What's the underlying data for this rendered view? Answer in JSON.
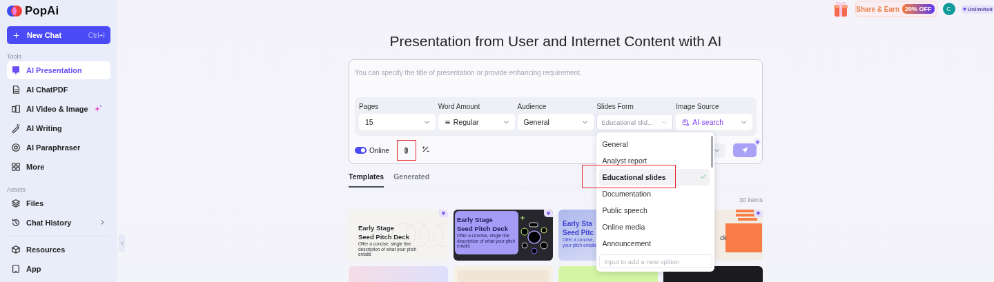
{
  "brand": {
    "name": "PopAi"
  },
  "new_chat": {
    "label": "New Chat",
    "shortcut": "Ctrl+I"
  },
  "sidebar": {
    "sections": [
      {
        "heading": "Tools",
        "items": [
          {
            "label": "AI Presentation",
            "selected": true,
            "sparkle": false,
            "submenu": false
          },
          {
            "label": "AI ChatPDF",
            "selected": false,
            "sparkle": false,
            "submenu": false
          },
          {
            "label": "AI Video & Image",
            "selected": false,
            "sparkle": true,
            "submenu": false
          },
          {
            "label": "AI Writing",
            "selected": false,
            "sparkle": false,
            "submenu": false
          },
          {
            "label": "AI Paraphraser",
            "selected": false,
            "sparkle": false,
            "submenu": false
          },
          {
            "label": "More",
            "selected": false,
            "sparkle": false,
            "submenu": false
          }
        ]
      },
      {
        "heading": "Assets",
        "items": [
          {
            "label": "Files",
            "selected": false,
            "sparkle": false,
            "submenu": false
          },
          {
            "label": "Chat History",
            "selected": false,
            "sparkle": false,
            "submenu": true
          }
        ]
      }
    ],
    "footer_items": [
      {
        "label": "Resources",
        "selected": false,
        "sparkle": false,
        "submenu": false
      },
      {
        "label": "App",
        "selected": false,
        "sparkle": false,
        "submenu": false
      }
    ]
  },
  "topbar": {
    "promo": {
      "label": "Share & Earn",
      "badge": "20% OFF"
    },
    "avatar": {
      "initial": "C"
    },
    "plan": {
      "label": "Unlimited"
    }
  },
  "title": "Presentation from User and Internet Content with AI",
  "prompt": {
    "placeholder": "You can specify the title of presentation or provide enhancing requirement."
  },
  "settings": [
    {
      "label": "Pages",
      "value": "15",
      "kind": "plain",
      "open": false
    },
    {
      "label": "Word Amount",
      "value": "Regular",
      "kind": "lines",
      "open": false
    },
    {
      "label": "Audience",
      "value": "General",
      "kind": "plain",
      "open": false
    },
    {
      "label": "Slides Form",
      "value": "Educational slid...",
      "kind": "plain",
      "open": true
    },
    {
      "label": "Image Source",
      "value": "AI-search",
      "kind": "image",
      "open": false
    }
  ],
  "toolbar": {
    "online": {
      "label": "Online",
      "on": true
    },
    "attach": {
      "annotated": true
    }
  },
  "dropdown": {
    "options": [
      {
        "label": "General",
        "selected": false,
        "annotated": false
      },
      {
        "label": "Analyst report",
        "selected": false,
        "annotated": false
      },
      {
        "label": "Educational slides",
        "selected": true,
        "annotated": true
      },
      {
        "label": "Documentation",
        "selected": false,
        "annotated": false
      },
      {
        "label": "Public speech",
        "selected": false,
        "annotated": false
      },
      {
        "label": "Online media",
        "selected": false,
        "annotated": false
      },
      {
        "label": "Announcement",
        "selected": false,
        "annotated": false
      }
    ],
    "new_option": {
      "placeholder": "Input to add a new opition"
    }
  },
  "tabs": [
    {
      "label": "Templates",
      "selected": true
    },
    {
      "label": "Generated",
      "selected": false
    }
  ],
  "count": "30 items",
  "templates": [
    {
      "kind": "beige",
      "premium": true,
      "title_lines": [
        "Early Stage",
        "Seed Pitch Deck"
      ],
      "description_lines": [
        "Offer a concise, single line",
        "description of what your pitch",
        "entails"
      ]
    },
    {
      "kind": "purple",
      "premium": true,
      "title_lines": [
        "Early Stage",
        "Seed Pitch Deck"
      ],
      "description_lines": [
        "Offer a concise, single line",
        "description of what your pitch",
        "entails"
      ]
    },
    {
      "kind": "blue",
      "title_lines": [
        "Early Sta",
        "Seed Pitc"
      ],
      "description_lines": [
        "Offer a concise,",
        "your pitch entails"
      ]
    },
    {
      "kind": "orange",
      "premium": true,
      "title_lines": [
        "ck"
      ]
    }
  ],
  "more_templates": [
    {
      "kind": "pink"
    },
    {
      "kind": "paper"
    },
    {
      "kind": "green"
    },
    {
      "kind": "dark"
    }
  ]
}
